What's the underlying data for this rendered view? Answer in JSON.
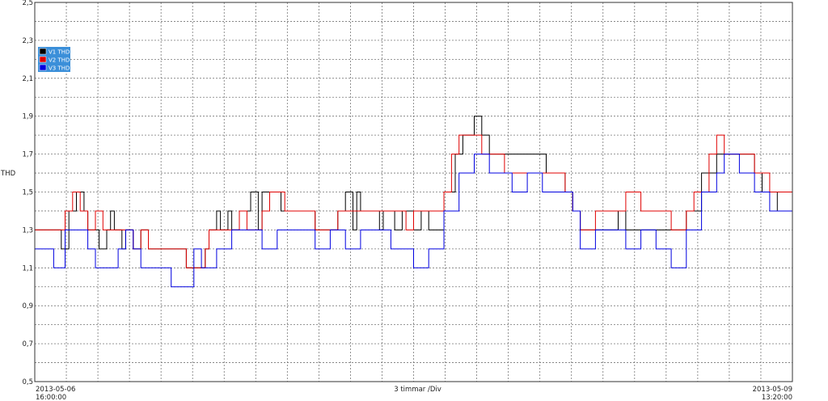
{
  "chart_data": {
    "type": "line",
    "ylabel": "THD",
    "xlabel": "3 timmar /Div",
    "ylim": [
      0.5,
      2.5
    ],
    "xlim": [
      0,
      1
    ],
    "yticks": [
      "0,5",
      "0,7",
      "0,9",
      "1,1",
      "1,3",
      "1,5",
      "1,7",
      "1,9",
      "2,1",
      "2,3",
      "2,5"
    ],
    "x_start_label": [
      "2013-05-06",
      "16:00:00"
    ],
    "x_end_label": [
      "2013-05-09",
      "13:20:00"
    ],
    "grid": true,
    "legend_position": "top-left",
    "series": [
      {
        "name": "V1 THD",
        "color": "#000000",
        "points": [
          [
            0.0,
            1.3
          ],
          [
            0.03,
            1.3
          ],
          [
            0.035,
            1.2
          ],
          [
            0.045,
            1.4
          ],
          [
            0.055,
            1.5
          ],
          [
            0.065,
            1.4
          ],
          [
            0.07,
            1.3
          ],
          [
            0.085,
            1.2
          ],
          [
            0.095,
            1.3
          ],
          [
            0.1,
            1.4
          ],
          [
            0.105,
            1.3
          ],
          [
            0.11,
            1.3
          ],
          [
            0.115,
            1.2
          ],
          [
            0.12,
            1.3
          ],
          [
            0.13,
            1.2
          ],
          [
            0.14,
            1.3
          ],
          [
            0.15,
            1.2
          ],
          [
            0.17,
            1.2
          ],
          [
            0.185,
            1.2
          ],
          [
            0.2,
            1.1
          ],
          [
            0.215,
            1.1
          ],
          [
            0.225,
            1.2
          ],
          [
            0.23,
            1.3
          ],
          [
            0.24,
            1.4
          ],
          [
            0.245,
            1.3
          ],
          [
            0.255,
            1.4
          ],
          [
            0.26,
            1.3
          ],
          [
            0.27,
            1.4
          ],
          [
            0.285,
            1.5
          ],
          [
            0.295,
            1.3
          ],
          [
            0.3,
            1.5
          ],
          [
            0.32,
            1.5
          ],
          [
            0.325,
            1.4
          ],
          [
            0.34,
            1.4
          ],
          [
            0.36,
            1.4
          ],
          [
            0.37,
            1.3
          ],
          [
            0.39,
            1.3
          ],
          [
            0.4,
            1.4
          ],
          [
            0.41,
            1.5
          ],
          [
            0.42,
            1.3
          ],
          [
            0.425,
            1.5
          ],
          [
            0.43,
            1.4
          ],
          [
            0.445,
            1.4
          ],
          [
            0.455,
            1.3
          ],
          [
            0.46,
            1.4
          ],
          [
            0.475,
            1.3
          ],
          [
            0.485,
            1.4
          ],
          [
            0.5,
            1.3
          ],
          [
            0.51,
            1.4
          ],
          [
            0.52,
            1.3
          ],
          [
            0.53,
            1.3
          ],
          [
            0.54,
            1.5
          ],
          [
            0.555,
            1.7
          ],
          [
            0.565,
            1.8
          ],
          [
            0.58,
            1.9
          ],
          [
            0.59,
            1.8
          ],
          [
            0.6,
            1.7
          ],
          [
            0.62,
            1.7
          ],
          [
            0.64,
            1.7
          ],
          [
            0.665,
            1.7
          ],
          [
            0.675,
            1.6
          ],
          [
            0.69,
            1.6
          ],
          [
            0.7,
            1.5
          ],
          [
            0.71,
            1.4
          ],
          [
            0.72,
            1.3
          ],
          [
            0.73,
            1.3
          ],
          [
            0.75,
            1.3
          ],
          [
            0.77,
            1.4
          ],
          [
            0.78,
            1.3
          ],
          [
            0.8,
            1.3
          ],
          [
            0.82,
            1.3
          ],
          [
            0.84,
            1.3
          ],
          [
            0.86,
            1.4
          ],
          [
            0.88,
            1.6
          ],
          [
            0.9,
            1.7
          ],
          [
            0.92,
            1.7
          ],
          [
            0.93,
            1.7
          ],
          [
            0.95,
            1.6
          ],
          [
            0.96,
            1.5
          ],
          [
            0.97,
            1.5
          ],
          [
            0.98,
            1.4
          ],
          [
            1.0,
            1.4
          ]
        ]
      },
      {
        "name": "V2 THD",
        "color": "#e00000",
        "points": [
          [
            0.0,
            1.3
          ],
          [
            0.03,
            1.3
          ],
          [
            0.04,
            1.4
          ],
          [
            0.05,
            1.5
          ],
          [
            0.06,
            1.4
          ],
          [
            0.07,
            1.3
          ],
          [
            0.08,
            1.4
          ],
          [
            0.09,
            1.3
          ],
          [
            0.1,
            1.3
          ],
          [
            0.11,
            1.3
          ],
          [
            0.12,
            1.3
          ],
          [
            0.13,
            1.2
          ],
          [
            0.14,
            1.3
          ],
          [
            0.15,
            1.2
          ],
          [
            0.17,
            1.2
          ],
          [
            0.18,
            1.2
          ],
          [
            0.2,
            1.1
          ],
          [
            0.215,
            1.1
          ],
          [
            0.225,
            1.2
          ],
          [
            0.23,
            1.3
          ],
          [
            0.25,
            1.3
          ],
          [
            0.27,
            1.4
          ],
          [
            0.28,
            1.3
          ],
          [
            0.3,
            1.4
          ],
          [
            0.31,
            1.5
          ],
          [
            0.33,
            1.4
          ],
          [
            0.35,
            1.4
          ],
          [
            0.37,
            1.3
          ],
          [
            0.4,
            1.4
          ],
          [
            0.43,
            1.4
          ],
          [
            0.45,
            1.4
          ],
          [
            0.47,
            1.4
          ],
          [
            0.49,
            1.3
          ],
          [
            0.5,
            1.4
          ],
          [
            0.52,
            1.4
          ],
          [
            0.54,
            1.5
          ],
          [
            0.55,
            1.7
          ],
          [
            0.56,
            1.8
          ],
          [
            0.58,
            1.8
          ],
          [
            0.59,
            1.7
          ],
          [
            0.6,
            1.7
          ],
          [
            0.62,
            1.6
          ],
          [
            0.64,
            1.6
          ],
          [
            0.66,
            1.6
          ],
          [
            0.68,
            1.6
          ],
          [
            0.7,
            1.5
          ],
          [
            0.71,
            1.4
          ],
          [
            0.72,
            1.3
          ],
          [
            0.74,
            1.4
          ],
          [
            0.76,
            1.4
          ],
          [
            0.78,
            1.5
          ],
          [
            0.8,
            1.4
          ],
          [
            0.82,
            1.4
          ],
          [
            0.84,
            1.3
          ],
          [
            0.86,
            1.4
          ],
          [
            0.87,
            1.5
          ],
          [
            0.89,
            1.7
          ],
          [
            0.9,
            1.8
          ],
          [
            0.91,
            1.7
          ],
          [
            0.93,
            1.7
          ],
          [
            0.95,
            1.6
          ],
          [
            0.97,
            1.5
          ],
          [
            1.0,
            1.4
          ]
        ]
      },
      {
        "name": "V3 THD",
        "color": "#0000e0",
        "points": [
          [
            0.0,
            1.2
          ],
          [
            0.02,
            1.2
          ],
          [
            0.025,
            1.1
          ],
          [
            0.035,
            1.1
          ],
          [
            0.04,
            1.3
          ],
          [
            0.06,
            1.3
          ],
          [
            0.07,
            1.2
          ],
          [
            0.08,
            1.1
          ],
          [
            0.1,
            1.1
          ],
          [
            0.11,
            1.2
          ],
          [
            0.12,
            1.3
          ],
          [
            0.13,
            1.2
          ],
          [
            0.14,
            1.1
          ],
          [
            0.15,
            1.1
          ],
          [
            0.17,
            1.1
          ],
          [
            0.18,
            1.0
          ],
          [
            0.2,
            1.0
          ],
          [
            0.21,
            1.2
          ],
          [
            0.22,
            1.1
          ],
          [
            0.23,
            1.1
          ],
          [
            0.24,
            1.2
          ],
          [
            0.26,
            1.3
          ],
          [
            0.28,
            1.3
          ],
          [
            0.3,
            1.2
          ],
          [
            0.32,
            1.3
          ],
          [
            0.35,
            1.3
          ],
          [
            0.37,
            1.2
          ],
          [
            0.39,
            1.3
          ],
          [
            0.41,
            1.2
          ],
          [
            0.43,
            1.3
          ],
          [
            0.45,
            1.3
          ],
          [
            0.47,
            1.2
          ],
          [
            0.49,
            1.2
          ],
          [
            0.5,
            1.1
          ],
          [
            0.52,
            1.2
          ],
          [
            0.53,
            1.2
          ],
          [
            0.54,
            1.4
          ],
          [
            0.56,
            1.6
          ],
          [
            0.58,
            1.7
          ],
          [
            0.6,
            1.6
          ],
          [
            0.62,
            1.6
          ],
          [
            0.63,
            1.5
          ],
          [
            0.65,
            1.6
          ],
          [
            0.67,
            1.5
          ],
          [
            0.69,
            1.5
          ],
          [
            0.7,
            1.5
          ],
          [
            0.71,
            1.4
          ],
          [
            0.72,
            1.2
          ],
          [
            0.74,
            1.3
          ],
          [
            0.76,
            1.3
          ],
          [
            0.78,
            1.2
          ],
          [
            0.8,
            1.3
          ],
          [
            0.82,
            1.2
          ],
          [
            0.84,
            1.1
          ],
          [
            0.86,
            1.3
          ],
          [
            0.87,
            1.3
          ],
          [
            0.88,
            1.5
          ],
          [
            0.9,
            1.6
          ],
          [
            0.91,
            1.7
          ],
          [
            0.93,
            1.6
          ],
          [
            0.95,
            1.5
          ],
          [
            0.97,
            1.4
          ],
          [
            1.0,
            1.4
          ]
        ]
      }
    ]
  }
}
